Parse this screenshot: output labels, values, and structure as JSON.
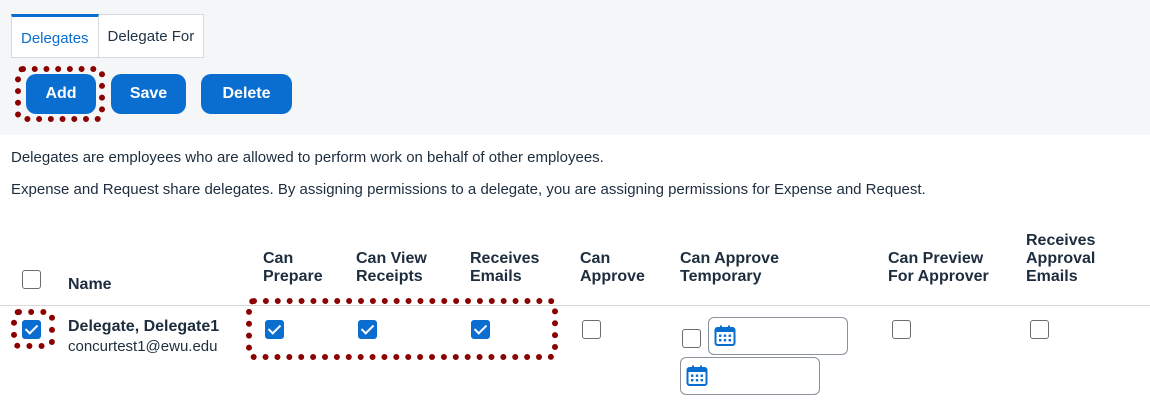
{
  "tabs": [
    {
      "label": "Delegates",
      "active": true
    },
    {
      "label": "Delegate For",
      "active": false
    }
  ],
  "toolbar": {
    "add_label": "Add",
    "save_label": "Save",
    "delete_label": "Delete"
  },
  "description": {
    "line1": "Delegates are employees who are allowed to perform work on behalf of other employees.",
    "line2": "Expense and Request share delegates. By assigning permissions to a delegate, you are assigning permissions for Expense and Request."
  },
  "table": {
    "columns": [
      {
        "key": "name",
        "label": "Name"
      },
      {
        "key": "can_prepare",
        "label": "Can\nPrepare"
      },
      {
        "key": "can_view_receipts",
        "label": "Can View\nReceipts"
      },
      {
        "key": "receives_emails",
        "label": "Receives\nEmails"
      },
      {
        "key": "can_approve",
        "label": "Can\nApprove"
      },
      {
        "key": "can_approve_temporary",
        "label": "Can Approve\nTemporary"
      },
      {
        "key": "can_preview_for_approver",
        "label": "Can Preview\nFor Approver"
      },
      {
        "key": "receives_approval_emails",
        "label": "Receives\nApproval\nEmails"
      }
    ],
    "rows": [
      {
        "selected": true,
        "name": "Delegate, Delegate1",
        "email": "concurtest1@ewu.edu",
        "can_prepare": true,
        "can_view_receipts": true,
        "receives_emails": true,
        "can_approve": false,
        "can_approve_temporary": false,
        "can_preview_for_approver": false,
        "receives_approval_emails": false
      }
    ]
  },
  "colors": {
    "accent": "#0a6ed1",
    "highlight": "#8b0000"
  },
  "icons": {
    "calendar": "calendar-icon"
  }
}
